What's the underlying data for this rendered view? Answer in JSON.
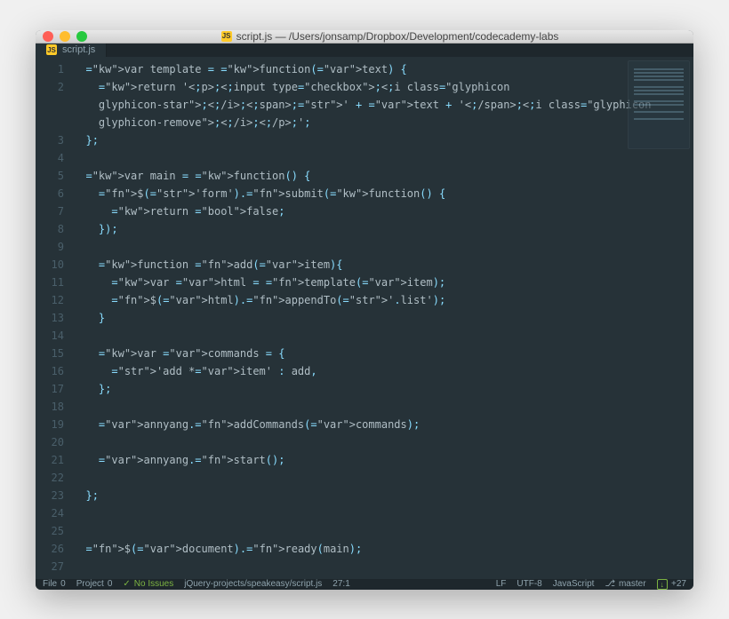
{
  "titlebar": {
    "file_icon": "JS",
    "title": "script.js — /Users/jonsamp/Dropbox/Development/codecademy-labs"
  },
  "tab": {
    "icon": "JS",
    "label": "script.js"
  },
  "code_lines": [
    "var template = function(text) {",
    "  return '<p><input type=\"checkbox\"><i class=\"glyphicon glyphicon-star\"></i><span>' + text + '</span><i class=\"glyphicon glyphicon-remove\"></i></p>';",
    "};",
    "",
    "var main = function() {",
    "  $('form').submit(function() {",
    "    return false;",
    "  });",
    "",
    "  function add(item){",
    "    var html = template(item);",
    "    $(html).appendTo('.list');",
    "  }",
    "",
    "  var commands = {",
    "    'add *item' : add,",
    "  };",
    "",
    "  annyang.addCommands(commands);",
    "",
    "  annyang.start();",
    "",
    "};",
    "",
    "",
    "$(document).ready(main);",
    ""
  ],
  "statusbar": {
    "file": "File",
    "file_count": "0",
    "project": "Project",
    "project_count": "0",
    "issues": "No Issues",
    "path": "jQuery-projects/speakeasy/script.js",
    "cursor": "27:1",
    "line_ending": "LF",
    "encoding": "UTF-8",
    "language": "JavaScript",
    "branch": "master",
    "git_changes": "+27"
  }
}
